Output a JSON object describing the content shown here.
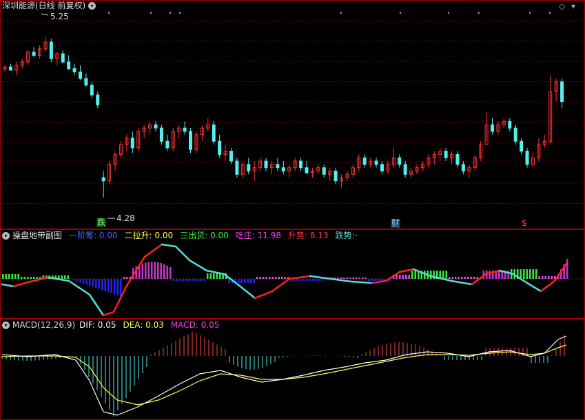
{
  "main": {
    "title": "深圳能源(日线 前复权)",
    "high_label": "5.25",
    "low_label": "4.28",
    "markers": [
      "跌",
      "财",
      "$"
    ]
  },
  "sub1": {
    "title": "操盘地带副图",
    "items": [
      {
        "label": "一阶筹:",
        "value": "0.00",
        "color": "#3a6bff"
      },
      {
        "label": "二拉升:",
        "value": "0.00",
        "color": "#ffff55"
      },
      {
        "label": "三出货:",
        "value": "0.00",
        "color": "#33ee33"
      },
      {
        "label": "吃庄:",
        "value": "11.98",
        "color": "#ee44ee"
      },
      {
        "label": "升势:",
        "value": "8.13",
        "color": "#ff3333"
      },
      {
        "label": "跌势:",
        "value": "-",
        "color": "#55dddd"
      }
    ]
  },
  "sub2": {
    "title": "MACD(12,26,9)",
    "items": [
      {
        "label": "DIF:",
        "value": "0.05",
        "color": "#ffffff"
      },
      {
        "label": "DEA:",
        "value": "0.03",
        "color": "#ffff55"
      },
      {
        "label": "MACD:",
        "value": "0.05",
        "color": "#ee44ee"
      }
    ]
  },
  "colors": {
    "up": "#ff3333",
    "down": "#55eeee",
    "grid": "#8b0000",
    "border": "#a00000",
    "label": "#dddddd"
  },
  "chart_data": {
    "type": "candlestick",
    "ylim": [
      4.15,
      5.35
    ],
    "annotations": [
      {
        "text": "5.25"
      },
      {
        "text": "4.28"
      }
    ],
    "ohlc": [
      [
        5.06,
        5.08,
        5.04,
        5.07
      ],
      [
        5.07,
        5.09,
        5.05,
        5.05
      ],
      [
        5.05,
        5.1,
        5.02,
        5.08
      ],
      [
        5.08,
        5.12,
        5.06,
        5.1
      ],
      [
        5.1,
        5.17,
        5.08,
        5.16
      ],
      [
        5.16,
        5.19,
        5.13,
        5.14
      ],
      [
        5.14,
        5.2,
        5.12,
        5.18
      ],
      [
        5.18,
        5.25,
        5.16,
        5.22
      ],
      [
        5.22,
        5.24,
        5.1,
        5.12
      ],
      [
        5.12,
        5.16,
        5.08,
        5.15
      ],
      [
        5.15,
        5.17,
        5.09,
        5.1
      ],
      [
        5.1,
        5.14,
        5.05,
        5.06
      ],
      [
        5.06,
        5.09,
        5.02,
        5.04
      ],
      [
        5.04,
        5.08,
        4.99,
        5.0
      ],
      [
        5.0,
        5.03,
        4.95,
        4.96
      ],
      [
        4.96,
        4.98,
        4.88,
        4.9
      ],
      [
        4.9,
        4.92,
        4.82,
        4.84
      ],
      [
        4.4,
        4.44,
        4.28,
        4.38
      ],
      [
        4.38,
        4.5,
        4.36,
        4.48
      ],
      [
        4.48,
        4.56,
        4.44,
        4.54
      ],
      [
        4.54,
        4.62,
        4.52,
        4.6
      ],
      [
        4.6,
        4.66,
        4.56,
        4.64
      ],
      [
        4.64,
        4.68,
        4.55,
        4.58
      ],
      [
        4.58,
        4.7,
        4.56,
        4.68
      ],
      [
        4.68,
        4.72,
        4.64,
        4.7
      ],
      [
        4.7,
        4.74,
        4.66,
        4.72
      ],
      [
        4.72,
        4.74,
        4.68,
        4.7
      ],
      [
        4.7,
        4.72,
        4.6,
        4.62
      ],
      [
        4.62,
        4.66,
        4.56,
        4.58
      ],
      [
        4.58,
        4.7,
        4.56,
        4.68
      ],
      [
        4.68,
        4.72,
        4.64,
        4.7
      ],
      [
        4.7,
        4.74,
        4.66,
        4.68
      ],
      [
        4.68,
        4.7,
        4.55,
        4.57
      ],
      [
        4.57,
        4.68,
        4.55,
        4.66
      ],
      [
        4.66,
        4.72,
        4.62,
        4.7
      ],
      [
        4.7,
        4.76,
        4.68,
        4.72
      ],
      [
        4.72,
        4.74,
        4.6,
        4.62
      ],
      [
        4.62,
        4.66,
        4.52,
        4.54
      ],
      [
        4.54,
        4.6,
        4.5,
        4.56
      ],
      [
        4.56,
        4.58,
        4.48,
        4.5
      ],
      [
        4.5,
        4.52,
        4.4,
        4.42
      ],
      [
        4.42,
        4.5,
        4.4,
        4.48
      ],
      [
        4.48,
        4.52,
        4.42,
        4.44
      ],
      [
        4.44,
        4.5,
        4.38,
        4.46
      ],
      [
        4.46,
        4.52,
        4.44,
        4.5
      ],
      [
        4.5,
        4.52,
        4.44,
        4.46
      ],
      [
        4.46,
        4.5,
        4.42,
        4.48
      ],
      [
        4.48,
        4.52,
        4.44,
        4.46
      ],
      [
        4.46,
        4.5,
        4.42,
        4.44
      ],
      [
        4.44,
        4.48,
        4.4,
        4.46
      ],
      [
        4.46,
        4.52,
        4.44,
        4.5
      ],
      [
        4.5,
        4.52,
        4.44,
        4.46
      ],
      [
        4.46,
        4.5,
        4.42,
        4.43
      ],
      [
        4.43,
        4.46,
        4.4,
        4.44
      ],
      [
        4.44,
        4.48,
        4.42,
        4.46
      ],
      [
        4.46,
        4.48,
        4.4,
        4.42
      ],
      [
        4.42,
        4.46,
        4.38,
        4.44
      ],
      [
        4.44,
        4.46,
        4.36,
        4.38
      ],
      [
        4.38,
        4.42,
        4.34,
        4.4
      ],
      [
        4.4,
        4.44,
        4.38,
        4.42
      ],
      [
        4.42,
        4.48,
        4.4,
        4.46
      ],
      [
        4.46,
        4.54,
        4.44,
        4.52
      ],
      [
        4.52,
        4.54,
        4.46,
        4.48
      ],
      [
        4.48,
        4.52,
        4.46,
        4.5
      ],
      [
        4.5,
        4.52,
        4.46,
        4.48
      ],
      [
        4.48,
        4.5,
        4.42,
        4.44
      ],
      [
        4.44,
        4.5,
        4.42,
        4.48
      ],
      [
        4.48,
        4.58,
        4.46,
        4.52
      ],
      [
        4.52,
        4.54,
        4.46,
        4.48
      ],
      [
        4.48,
        4.5,
        4.4,
        4.42
      ],
      [
        4.42,
        4.46,
        4.4,
        4.44
      ],
      [
        4.44,
        4.48,
        4.42,
        4.46
      ],
      [
        4.46,
        4.5,
        4.44,
        4.48
      ],
      [
        4.48,
        4.54,
        4.46,
        4.52
      ],
      [
        4.52,
        4.56,
        4.48,
        4.54
      ],
      [
        4.54,
        4.58,
        4.5,
        4.56
      ],
      [
        4.56,
        4.58,
        4.5,
        4.52
      ],
      [
        4.52,
        4.56,
        4.48,
        4.54
      ],
      [
        4.54,
        4.56,
        4.46,
        4.48
      ],
      [
        4.48,
        4.5,
        4.42,
        4.44
      ],
      [
        4.44,
        4.48,
        4.4,
        4.46
      ],
      [
        4.46,
        4.54,
        4.44,
        4.52
      ],
      [
        4.52,
        4.62,
        4.5,
        4.6
      ],
      [
        4.6,
        4.62,
        4.8,
        4.72
      ],
      [
        4.72,
        4.76,
        4.66,
        4.68
      ],
      [
        4.68,
        4.74,
        4.66,
        4.72
      ],
      [
        4.72,
        4.76,
        4.7,
        4.74
      ],
      [
        4.74,
        4.76,
        4.68,
        4.7
      ],
      [
        4.7,
        4.72,
        4.6,
        4.62
      ],
      [
        4.62,
        4.64,
        4.54,
        4.56
      ],
      [
        4.56,
        4.58,
        4.46,
        4.48
      ],
      [
        4.48,
        4.56,
        4.46,
        4.52
      ],
      [
        4.52,
        4.64,
        4.5,
        4.6
      ],
      [
        4.6,
        4.66,
        4.58,
        4.62
      ],
      [
        4.62,
        5.02,
        4.6,
        4.92
      ],
      [
        4.92,
        5.0,
        4.86,
        4.98
      ],
      [
        4.98,
        5.0,
        4.82,
        4.86
      ]
    ],
    "macd": {
      "dif": 0.05,
      "dea": 0.03,
      "macd": 0.05
    }
  }
}
